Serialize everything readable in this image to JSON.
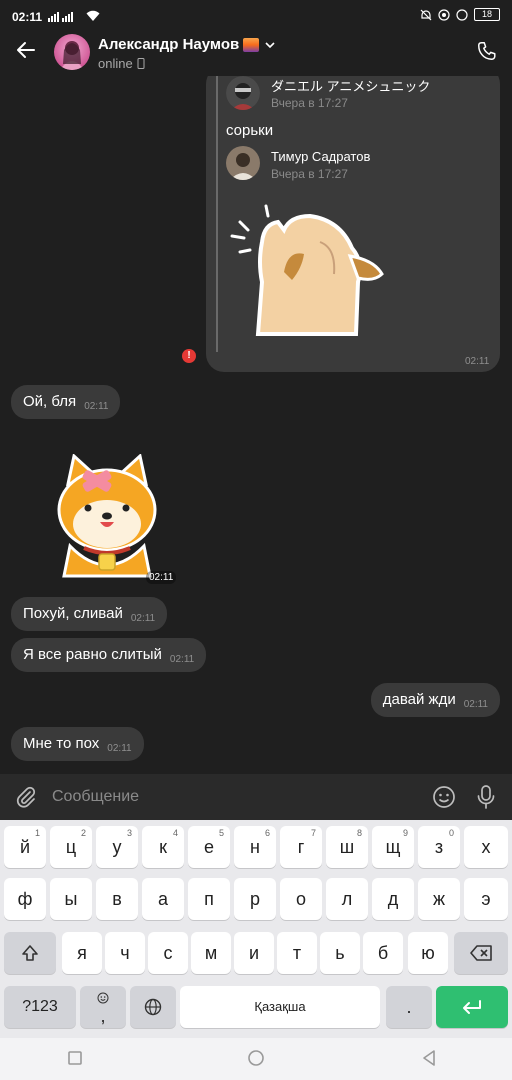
{
  "status_bar": {
    "time": "02:11",
    "battery": "18"
  },
  "header": {
    "contact_name": "Александр Наумов",
    "status": "online"
  },
  "forwarded": {
    "author1": "ダニエル アニメシュニック",
    "time1": "Вчера в 17:27",
    "text": "сорьки",
    "author2": "Тимур Садратов",
    "time2": "Вчера в 17:27",
    "time_sent": "02:11"
  },
  "messages": [
    {
      "text": "Ой, бля",
      "time": "02:11"
    },
    {
      "text": "Похуй, сливай",
      "time": "02:11"
    },
    {
      "text": "Я все равно слитый",
      "time": "02:11"
    },
    {
      "text": "давай жди",
      "time": "02:11"
    },
    {
      "text": "Мне то пох",
      "time": "02:11"
    }
  ],
  "sticker_time": "02:11",
  "composer": {
    "placeholder": "Сообщение"
  },
  "keyboard": {
    "row1": [
      {
        "k": "й",
        "s": "1"
      },
      {
        "k": "ц",
        "s": "2"
      },
      {
        "k": "у",
        "s": "3"
      },
      {
        "k": "к",
        "s": "4"
      },
      {
        "k": "е",
        "s": "5"
      },
      {
        "k": "н",
        "s": "6"
      },
      {
        "k": "г",
        "s": "7"
      },
      {
        "k": "ш",
        "s": "8"
      },
      {
        "k": "щ",
        "s": "9"
      },
      {
        "k": "з",
        "s": "0"
      },
      {
        "k": "х",
        "s": ""
      }
    ],
    "row2": [
      "ф",
      "ы",
      "в",
      "а",
      "п",
      "р",
      "о",
      "л",
      "д",
      "ж",
      "э"
    ],
    "row3": [
      "я",
      "ч",
      "с",
      "м",
      "и",
      "т",
      "ь",
      "б",
      "ю"
    ],
    "numbers": "?123",
    "comma": ",",
    "space": "Қазақша",
    "period": "."
  },
  "colors": {
    "bubble": "#3a3a3a",
    "background": "#1f1f1f",
    "enter": "#2fbf71",
    "error": "#e53935"
  }
}
